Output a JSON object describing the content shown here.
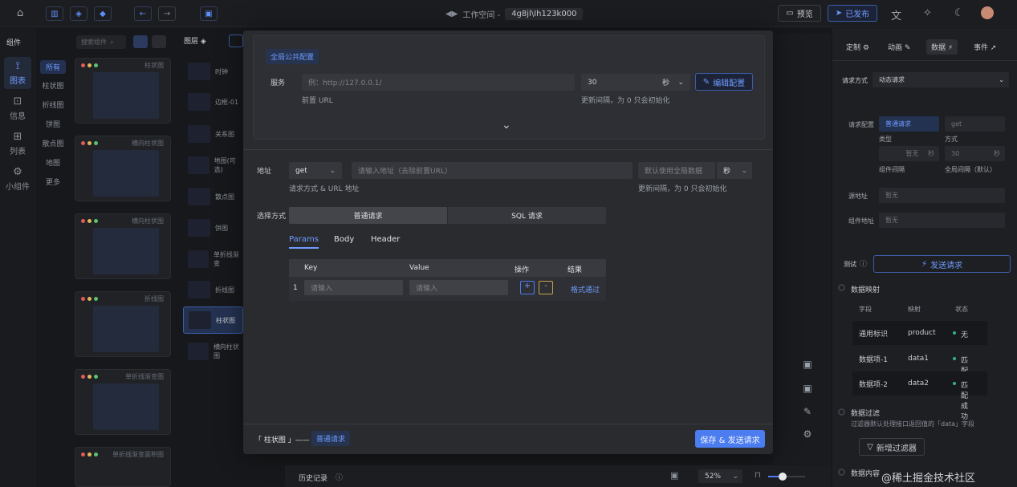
{
  "topbar": {
    "workspace_label": "工作空间 -",
    "workspace_code": "4g8jl\\Ih123k000",
    "preview": "预览",
    "publish": "已发布"
  },
  "left": {
    "components_title": "组件",
    "search_placeholder": "搜索组件",
    "nav": [
      {
        "icon": "chart-icon",
        "label": "图表"
      },
      {
        "icon": "info-icon",
        "label": "信息"
      },
      {
        "icon": "table-icon",
        "label": "列表"
      },
      {
        "icon": "widget-icon",
        "label": "小组件"
      }
    ],
    "subcats": [
      "所有",
      "柱状图",
      "折线图",
      "饼图",
      "散点图",
      "地图",
      "更多"
    ],
    "thumbs": [
      "柱状图",
      "横向柱状图",
      "横向柱状图",
      "折线图",
      "单折线渐变图",
      "单折线渐变面积图"
    ],
    "layers_title": "图层",
    "layers": [
      "时钟",
      "边框-01",
      "关系图",
      "地图(可选)",
      "散点图",
      "饼图",
      "单折线渐变",
      "折线图",
      "柱状图",
      "横向柱状图"
    ]
  },
  "modal": {
    "global_tag": "全局公共配置",
    "service_label": "服务",
    "service_placeholder": "例：http://127.0.0.1/",
    "service_hint": "前置 URL",
    "interval_value": "30",
    "interval_unit": "秒",
    "interval_hint": "更新间隔，为 0 只会初始化",
    "edit_config": "编辑配置",
    "address_label": "地址",
    "method": "get",
    "url_placeholder": "请输入地址（去除前置URL）",
    "address_hint": "请求方式 & URL 地址",
    "global_interval": "默认使用全局数据",
    "unit2": "秒",
    "interval_hint2": "更新间隔，为 0 只会初始化",
    "choose_label": "选择方式",
    "mode_normal": "普通请求",
    "mode_sql": "SQL 请求",
    "tabs": [
      "Params",
      "Body",
      "Header"
    ],
    "cols": [
      "Key",
      "Value",
      "操作",
      "结果"
    ],
    "row_index": "1",
    "key_placeholder": "请输入",
    "value_placeholder": "请输入",
    "plus": "+",
    "minus": "-",
    "result": "格式通过",
    "footer_chart": "「 柱状图 」——",
    "footer_tag": "普通请求",
    "save_btn": "保存 & 发送请求"
  },
  "right": {
    "tabs": [
      "定制",
      "动画",
      "数据",
      "事件"
    ],
    "req_mode_label": "请求方式",
    "req_mode": "动态请求",
    "req_cfg_label": "请求配置",
    "req_type": "普通请求",
    "req_method": "get",
    "type_label": "类型",
    "method_label": "方式",
    "interval_none": "暂无",
    "unit": "秒",
    "global_interval": "30",
    "comp_interval_label": "组件间隔",
    "global_interval_label": "全局间隔（默认）",
    "source_label": "源地址",
    "source_val": "暂无",
    "comp_addr_label": "组件地址",
    "comp_addr_val": "暂无",
    "test_label": "测试",
    "send_btn": "发送请求",
    "mapping_title": "数据映射",
    "map_cols": [
      "字段",
      "映射",
      "状态"
    ],
    "map_rows": [
      {
        "field": "通用标识",
        "map": "product",
        "status": "无"
      },
      {
        "field": "数据项-1",
        "map": "data1",
        "status": "匹配成功"
      },
      {
        "field": "数据项-2",
        "map": "data2",
        "status": "匹配成功"
      }
    ],
    "filter_title": "数据过滤",
    "filter_desc": "过滤器默认处理接口返回值的「data」字段",
    "add_filter": "新增过滤器",
    "content_title": "数据内容"
  },
  "bottom": {
    "history": "历史记录",
    "zoom": "52%",
    "watermark": "@稀土掘金技术社区"
  }
}
